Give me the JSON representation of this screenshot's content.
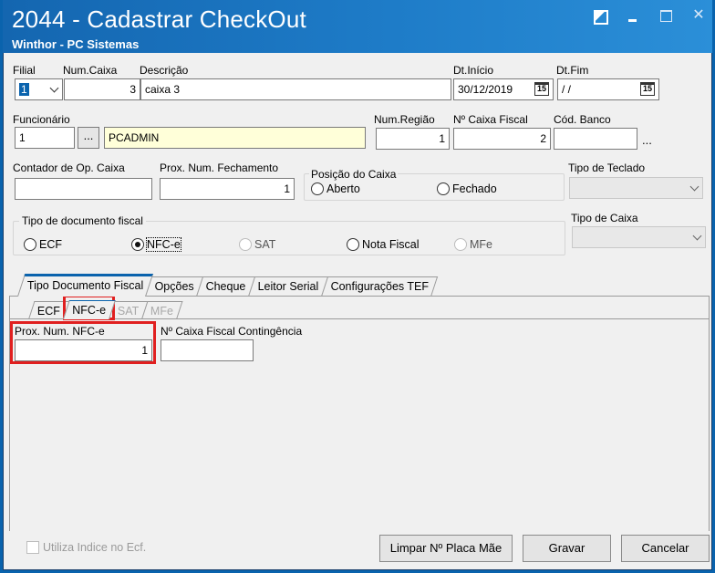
{
  "window": {
    "title": "2044 - Cadastrar CheckOut",
    "subtitle": "Winthor - PC Sistemas"
  },
  "form": {
    "filial_label": "Filial",
    "filial_value": "1",
    "num_caixa_label": "Num.Caixa",
    "num_caixa_value": "3",
    "descricao_label": "Descrição",
    "descricao_value": "caixa 3",
    "dt_inicio_label": "Dt.Início",
    "dt_inicio_value": "30/12/2019",
    "dt_fim_label": "Dt.Fim",
    "dt_fim_value": " / /",
    "date_icon_text": "15",
    "funcionario_label": "Funcionário",
    "funcionario_value": "1",
    "funcionario_lookup": "...",
    "funcionario_nome": "PCADMIN",
    "num_regiao_label": "Num.Região",
    "num_regiao_value": "1",
    "caixa_fiscal_label": "Nº Caixa Fiscal",
    "caixa_fiscal_value": "2",
    "cod_banco_label": "Cód. Banco",
    "cod_banco_value": "",
    "cod_banco_lookup": "...",
    "contador_label": "Contador de Op. Caixa",
    "contador_value": "",
    "prox_fechamento_label": "Prox. Num. Fechamento",
    "prox_fechamento_value": "1",
    "posicao_label": "Posição do Caixa",
    "posicao_options": [
      "Aberto",
      "Fechado"
    ],
    "tipo_teclado_label": "Tipo de Teclado",
    "tipo_doc_label": "Tipo de documento fiscal",
    "tipo_doc_options": [
      "ECF",
      "NFC-e",
      "SAT",
      "Nota Fiscal",
      "MFe"
    ],
    "tipo_doc_selected": "NFC-e",
    "tipo_caixa_label": "Tipo de Caixa"
  },
  "tabs": {
    "main": [
      "Tipo Documento Fiscal",
      "Opções",
      "Cheque",
      "Leitor Serial",
      "Configurações TEF"
    ],
    "sub": [
      "ECF",
      "NFC-e",
      "SAT",
      "MFe"
    ]
  },
  "nfce": {
    "prox_num_label": "Prox. Num. NFC-e",
    "prox_num_value": "1",
    "contingencia_label": "Nº Caixa Fiscal Contingência",
    "contingencia_value": ""
  },
  "footer": {
    "checkbox_label": "Utiliza Indice no Ecf.",
    "limpar_button": "Limpar Nº Placa Mãe",
    "gravar_button": "Gravar",
    "cancelar_button": "Cancelar"
  },
  "colors": {
    "titlebar": "#1466b0",
    "highlight": "#e02020",
    "selection": "#0a63ad"
  }
}
